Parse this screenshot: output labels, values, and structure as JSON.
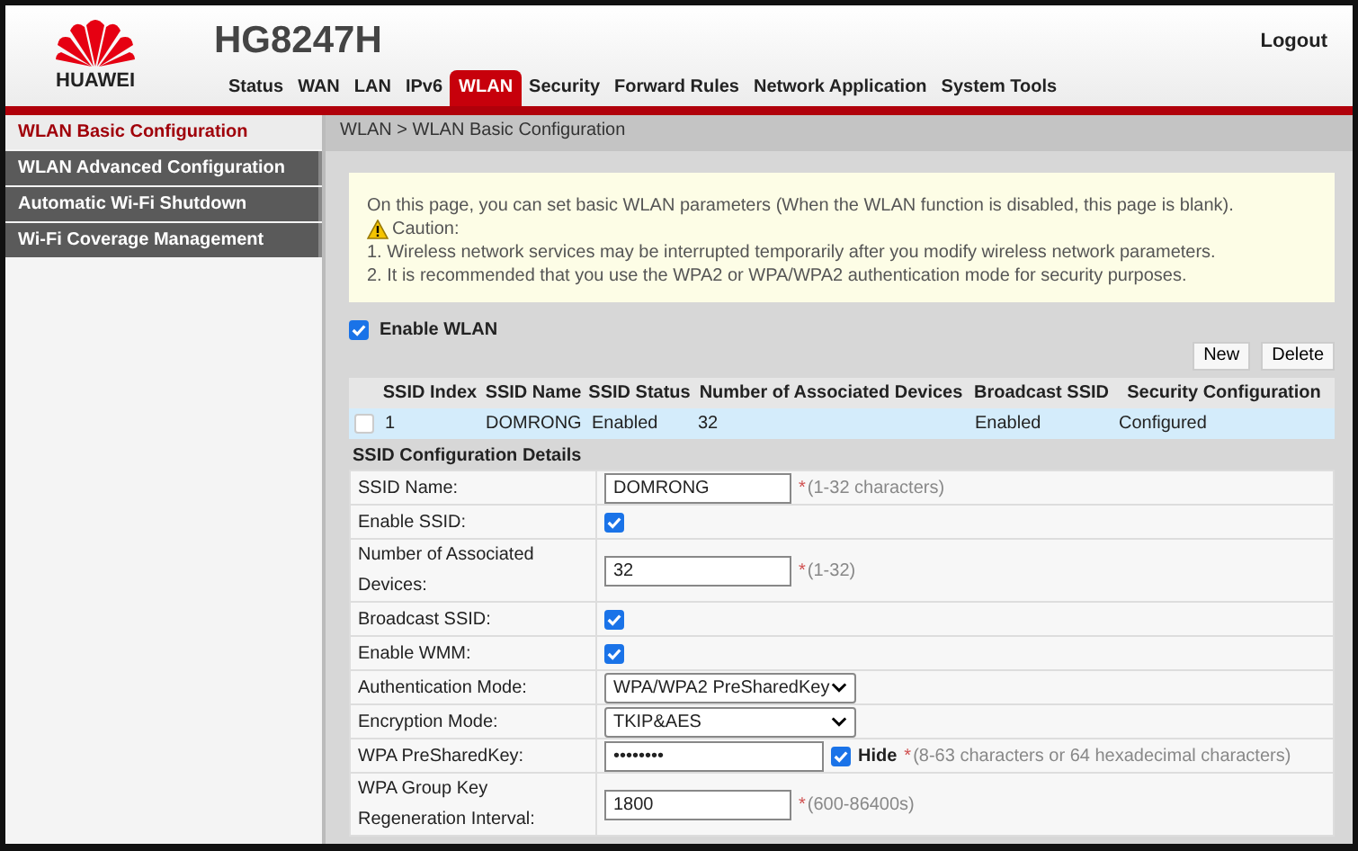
{
  "header": {
    "brand": "HUAWEI",
    "model": "HG8247H",
    "logout": "Logout"
  },
  "tabs": [
    {
      "label": "Status",
      "selected": false
    },
    {
      "label": "WAN",
      "selected": false
    },
    {
      "label": "LAN",
      "selected": false
    },
    {
      "label": "IPv6",
      "selected": false
    },
    {
      "label": "WLAN",
      "selected": true
    },
    {
      "label": "Security",
      "selected": false
    },
    {
      "label": "Forward Rules",
      "selected": false
    },
    {
      "label": "Network Application",
      "selected": false
    },
    {
      "label": "System Tools",
      "selected": false
    }
  ],
  "sidebar": {
    "items": [
      {
        "label": "WLAN Basic Configuration",
        "selected": true
      },
      {
        "label": "WLAN Advanced Configuration",
        "selected": false
      },
      {
        "label": "Automatic Wi-Fi Shutdown",
        "selected": false
      },
      {
        "label": "Wi-Fi Coverage Management",
        "selected": false
      }
    ]
  },
  "breadcrumb": "WLAN > WLAN Basic Configuration",
  "notice": {
    "intro": "On this page, you can set basic WLAN parameters (When the WLAN function is disabled, this page is blank).",
    "caution": "Caution:",
    "points": [
      "1. Wireless network services may be interrupted temporarily after you modify wireless network parameters.",
      "2. It is recommended that you use the WPA2 or WPA/WPA2 authentication mode for security purposes."
    ]
  },
  "enable_wlan": {
    "label": "Enable WLAN",
    "checked": true
  },
  "buttons": [
    "New",
    "Delete"
  ],
  "table": {
    "columns": [
      "SSID Index",
      "SSID Name",
      "SSID Status",
      "Number of Associated Devices",
      "Broadcast SSID",
      "Security Configuration"
    ],
    "rows": [
      {
        "selected": true,
        "checked": false,
        "cells": [
          "1",
          "DOMRONG",
          "Enabled",
          "32",
          "Enabled",
          "Configured"
        ]
      }
    ]
  },
  "details": {
    "title": "SSID Configuration Details",
    "fields": [
      {
        "kind": "text",
        "label": "SSID Name:",
        "value": "DOMRONG",
        "mark": "*",
        "hint": "(1-32 characters)"
      },
      {
        "kind": "checkbox",
        "label": "Enable SSID:",
        "checked": true
      },
      {
        "kind": "text",
        "label": "Number of Associated Devices:",
        "value": "32",
        "mark": "*",
        "hint": "(1-32)"
      },
      {
        "kind": "checkbox",
        "label": "Broadcast SSID:",
        "checked": true
      },
      {
        "kind": "checkbox",
        "label": "Enable WMM:",
        "checked": true
      },
      {
        "kind": "select",
        "label": "Authentication Mode:",
        "value": "WPA/WPA2 PreSharedKey"
      },
      {
        "kind": "select",
        "label": "Encryption Mode:",
        "value": "TKIP&AES"
      },
      {
        "kind": "password",
        "label": "WPA PreSharedKey:",
        "value": "••••••••",
        "hide_label": "Hide",
        "checked": true,
        "mark": "*",
        "hint": "(8-63 characters or 64 hexadecimal characters)"
      },
      {
        "kind": "text",
        "label": "WPA Group Key Regeneration Interval:",
        "value": "1800",
        "mark": "*",
        "hint": "(600-86400s)"
      }
    ]
  }
}
